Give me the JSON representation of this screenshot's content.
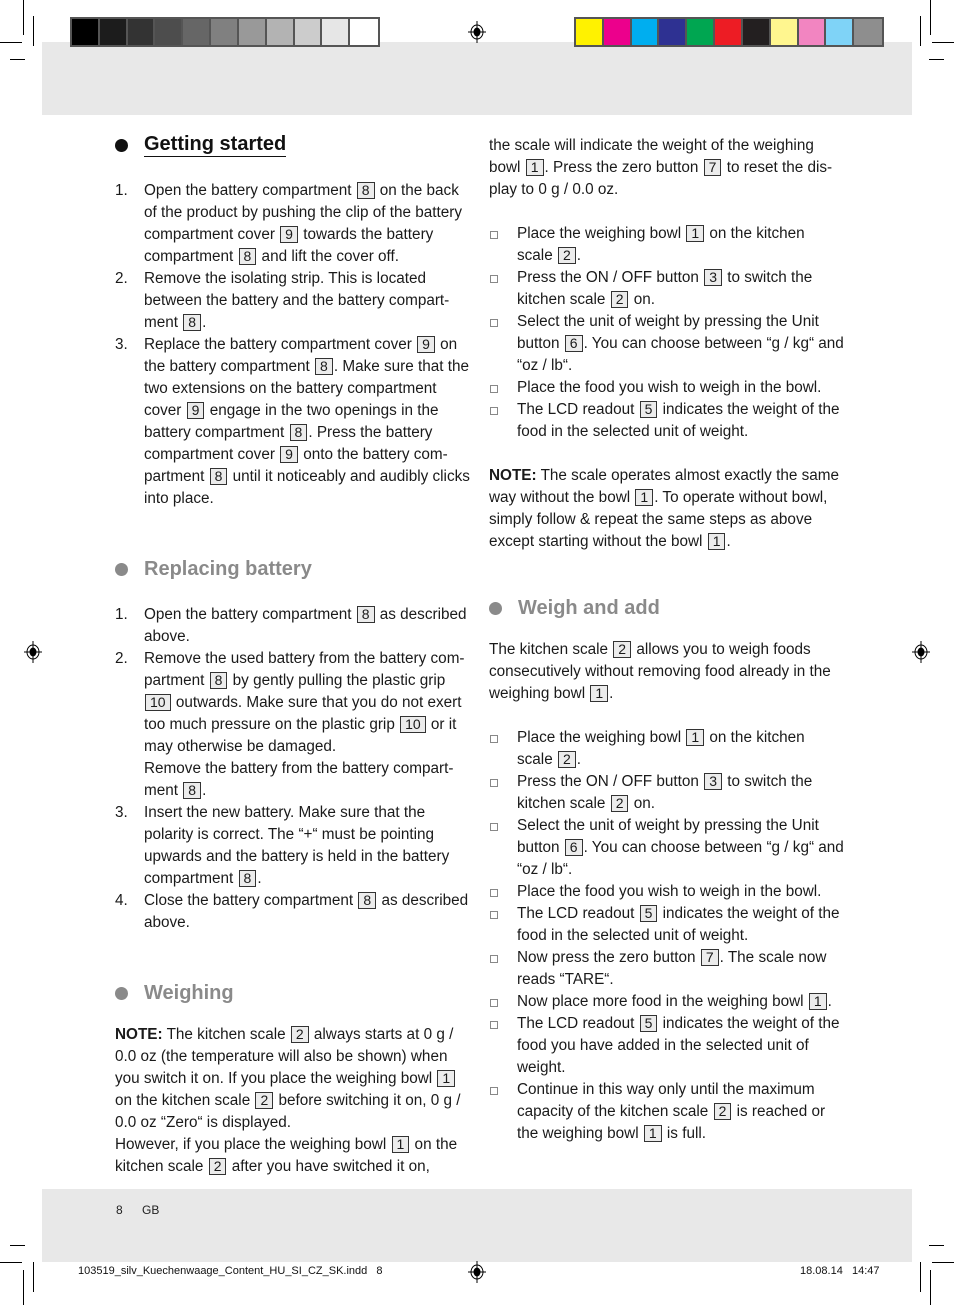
{
  "print_marks": {
    "gray_swatches": [
      "#000000",
      "#1c1c1c",
      "#333333",
      "#4d4d4d",
      "#666666",
      "#808080",
      "#999999",
      "#b3b3b3",
      "#cccccc",
      "#e6e6e6",
      "#ffffff"
    ],
    "color_swatches": [
      "#fff200",
      "#ec008c",
      "#00aeef",
      "#2e3192",
      "#00a651",
      "#ed1c24",
      "#231f20",
      "#fff68f",
      "#f285c1",
      "#7fd3f7",
      "#8e8e8e"
    ]
  },
  "sections": {
    "getting_started": {
      "title": "Getting started",
      "steps": [
        {
          "num": "1.",
          "parts": [
            "Open the battery compartment ",
            {
              "ref": "8"
            },
            " on the back of the product by pushing the clip of the battery compartment cover ",
            {
              "ref": "9"
            },
            " towards the battery compartment ",
            {
              "ref": "8"
            },
            " and lift the cover off."
          ]
        },
        {
          "num": "2.",
          "parts": [
            "Remove the isolating strip. This is located between the battery and the battery compart-ment ",
            {
              "ref": "8"
            },
            "."
          ]
        },
        {
          "num": "3.",
          "parts": [
            "Replace the battery compartment cover ",
            {
              "ref": "9"
            },
            " on the battery compartment ",
            {
              "ref": "8"
            },
            ". Make sure that the two extensions on the battery compartment cover ",
            {
              "ref": "9"
            },
            " engage in the two openings in the battery compartment ",
            {
              "ref": "8"
            },
            ". Press the battery compartment cover ",
            {
              "ref": "9"
            },
            " onto the battery com-partment ",
            {
              "ref": "8"
            },
            " until it noticeably and audibly clicks into place."
          ]
        }
      ]
    },
    "replacing_battery": {
      "title": "Replacing battery",
      "steps": [
        {
          "num": "1.",
          "parts": [
            "Open the battery compartment ",
            {
              "ref": "8"
            },
            " as described above."
          ]
        },
        {
          "num": "2.",
          "parts": [
            "Remove the used battery from the battery com-partment ",
            {
              "ref": "8"
            },
            " by gently pulling the plastic grip ",
            {
              "ref": "10"
            },
            " outwards. Make sure that you do not exert too much pressure on the plastic grip ",
            {
              "ref": "10"
            },
            " or it may otherwise be damaged.\nRemove the battery from the battery compart-ment ",
            {
              "ref": "8"
            },
            "."
          ]
        },
        {
          "num": "3.",
          "parts": [
            "Insert the new battery. Make sure that the polarity is correct. The “+“ must be pointing upwards and the battery is held in the battery compartment ",
            {
              "ref": "8"
            },
            "."
          ]
        },
        {
          "num": "4.",
          "parts": [
            "Close the battery compartment ",
            {
              "ref": "8"
            },
            " as described above."
          ]
        }
      ]
    },
    "weighing": {
      "title": "Weighing",
      "note_label": "NOTE:",
      "note_parts": [
        " The kitchen scale ",
        {
          "ref": "2"
        },
        " always starts at 0 g / 0.0 oz (the temperature will also be shown) when you switch it on. If you place the weighing bowl ",
        {
          "ref": "1"
        },
        " on the kitchen scale ",
        {
          "ref": "2"
        },
        " before switching it on, 0 g / 0.0 oz “Zero“ is displayed.\nHowever, if you place the weighing bowl ",
        {
          "ref": "1"
        },
        " on the kitchen scale ",
        {
          "ref": "2"
        },
        " after you have switched it on, the scale will indicate the weight of the weighing bowl ",
        {
          "ref": "1"
        },
        ". Press the zero button ",
        {
          "ref": "7"
        },
        " to reset the dis-play to 0 g /  0.0 oz."
      ],
      "bullets": [
        [
          "Place the weighing bowl ",
          {
            "ref": "1"
          },
          " on the kitchen scale ",
          {
            "ref": "2"
          },
          "."
        ],
        [
          "Press the ON / OFF button ",
          {
            "ref": "3"
          },
          " to switch the kitchen scale ",
          {
            "ref": "2"
          },
          " on."
        ],
        [
          "Select the unit of weight by pressing the Unit button ",
          {
            "ref": "6"
          },
          ". You can choose between “g / kg“ and “oz / lb“."
        ],
        [
          "Place the food you wish to weigh in the bowl."
        ],
        [
          "The LCD readout ",
          {
            "ref": "5"
          },
          " indicates the weight of the food in the selected unit of weight."
        ]
      ],
      "note2_label": "NOTE:",
      "note2_parts": [
        " The scale operates almost exactly the same way without the bowl ",
        {
          "ref": "1"
        },
        ". To operate without bowl, simply follow & repeat the same steps as above except starting without the bowl ",
        {
          "ref": "1"
        },
        "."
      ]
    },
    "weigh_and_add": {
      "title": "Weigh and add",
      "intro_parts": [
        "The kitchen scale ",
        {
          "ref": "2"
        },
        " allows you to weigh foods consecutively without removing food already in the weighing bowl ",
        {
          "ref": "1"
        },
        "."
      ],
      "bullets": [
        [
          "Place the weighing bowl ",
          {
            "ref": "1"
          },
          " on the kitchen scale ",
          {
            "ref": "2"
          },
          "."
        ],
        [
          "Press the ON / OFF button ",
          {
            "ref": "3"
          },
          " to switch the kitchen scale ",
          {
            "ref": "2"
          },
          " on."
        ],
        [
          "Select the unit of weight by pressing the Unit button ",
          {
            "ref": "6"
          },
          ". You can choose between “g / kg“ and “oz / lb“."
        ],
        [
          "Place the food you wish to weigh in the bowl."
        ],
        [
          "The LCD readout ",
          {
            "ref": "5"
          },
          " indicates the weight of the food in the selected unit of weight."
        ],
        [
          "Now press the zero button ",
          {
            "ref": "7"
          },
          ". The scale now reads “TARE“."
        ],
        [
          "Now place more food in the weighing bowl ",
          {
            "ref": "1"
          },
          "."
        ],
        [
          "The LCD readout ",
          {
            "ref": "5"
          },
          " indicates the weight of the food you have added in the selected unit of weight."
        ],
        [
          "Continue in this way only until the maximum capacity of the kitchen scale ",
          {
            "ref": "2"
          },
          " is reached or the weighing bowl ",
          {
            "ref": "1"
          },
          " is full."
        ]
      ]
    }
  },
  "footer": {
    "page_number": "8",
    "language": "GB",
    "slug_file": "103519_silv_Kuechenwaage_Content_HU_SI_CZ_SK.indd   8",
    "slug_date": "18.08.14   14:47"
  }
}
